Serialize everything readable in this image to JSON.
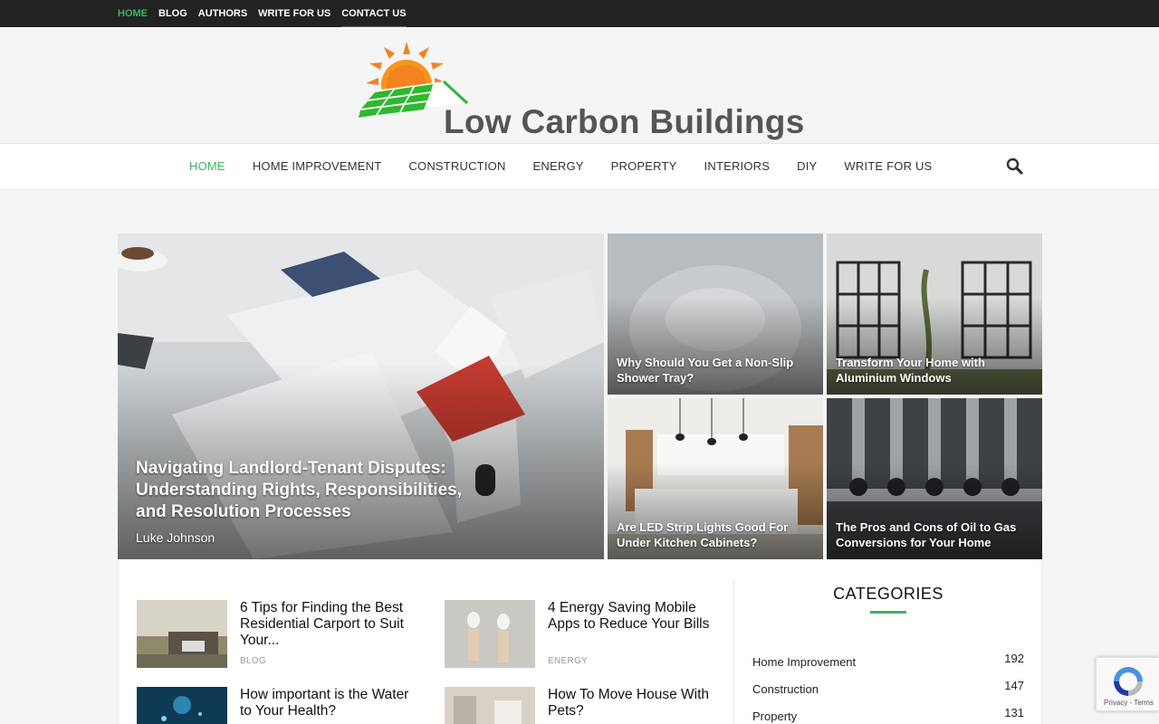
{
  "topbar": {
    "items": [
      {
        "label": "HOME",
        "active": true
      },
      {
        "label": "BLOG"
      },
      {
        "label": "AUTHORS"
      },
      {
        "label": "WRITE FOR US"
      },
      {
        "label": "CONTACT US"
      }
    ]
  },
  "header": {
    "logo_text": "Low Carbon Buildings",
    "logo_icon": "sun-over-solar-panel-roof"
  },
  "mainnav": {
    "items": [
      {
        "label": "HOME",
        "active": true
      },
      {
        "label": "HOME IMPROVEMENT"
      },
      {
        "label": "CONSTRUCTION"
      },
      {
        "label": "ENERGY"
      },
      {
        "label": "PROPERTY"
      },
      {
        "label": "INTERIORS"
      },
      {
        "label": "DIY"
      },
      {
        "label": "WRITE FOR US"
      }
    ],
    "search_icon": "search-icon"
  },
  "hero": {
    "main": {
      "title": "Navigating Landlord-Tenant Disputes: Understanding Rights, Responsibilities, and Resolution Processes",
      "author": "Luke Johnson"
    },
    "tiles": [
      {
        "title": "Why Should You Get a Non-Slip Shower Tray?"
      },
      {
        "title": "Transform Your Home with Aluminium Windows"
      },
      {
        "title": "Are LED Strip Lights Good For Under Kitchen Cabinets?"
      },
      {
        "title": "The Pros and Cons of Oil to Gas Conversions for Your Home"
      }
    ]
  },
  "posts": [
    {
      "title": "6 Tips for Finding the Best Residential Carport to Suit Your...",
      "category": "BLOG"
    },
    {
      "title": "4 Energy Saving Mobile Apps to Reduce Your Bills",
      "category": "ENERGY"
    },
    {
      "title": "How important is the Water to Your Health?",
      "category": ""
    },
    {
      "title": "How To Move House With Pets?",
      "category": ""
    }
  ],
  "sidebar": {
    "heading": "CATEGORIES",
    "categories": [
      {
        "name": "Home Improvement",
        "count": "192"
      },
      {
        "name": "Construction",
        "count": "147"
      },
      {
        "name": "Property",
        "count": "131"
      }
    ]
  },
  "recaptcha": {
    "terms": "Privacy - Terms"
  },
  "colors": {
    "accent": "#3eb55f",
    "topbar_bg": "#222222",
    "logo_orange": "#f58220",
    "logo_green": "#2eb82e"
  }
}
